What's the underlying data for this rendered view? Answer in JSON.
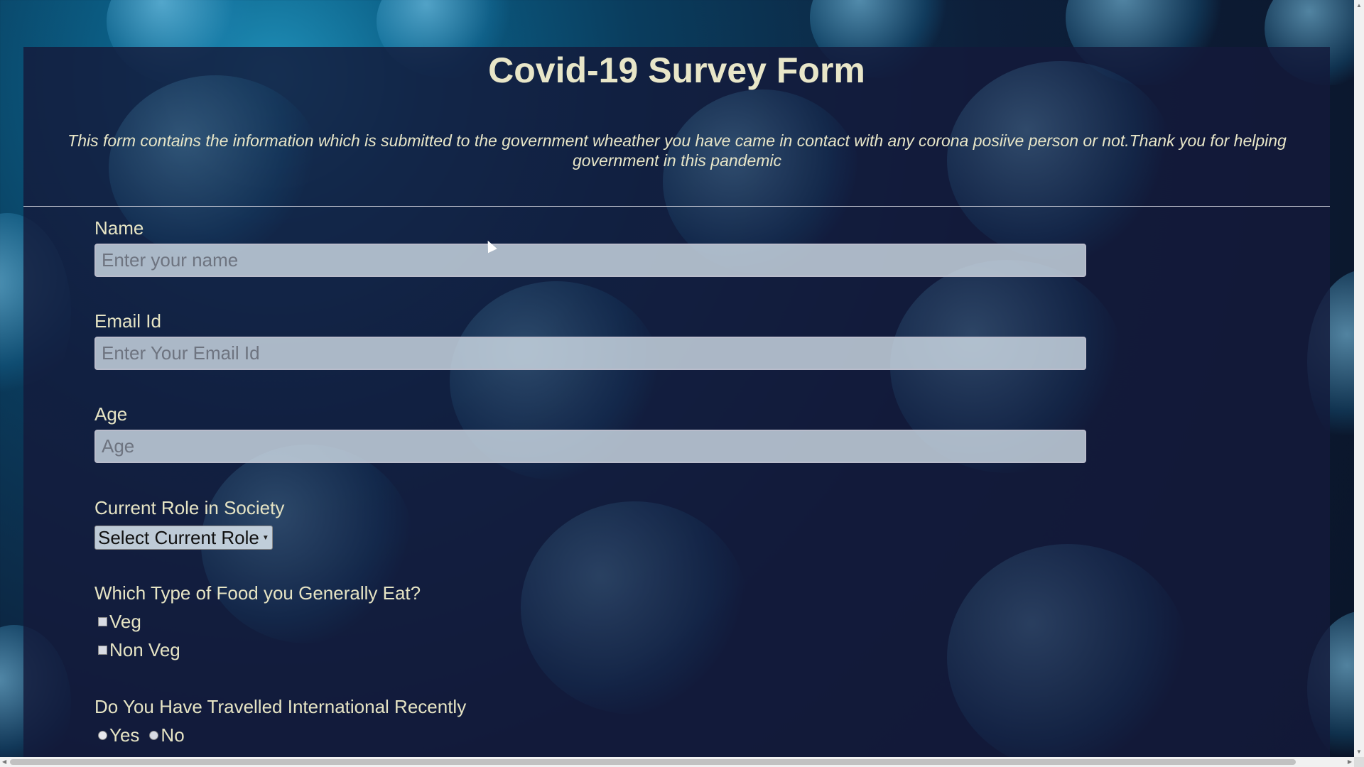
{
  "page": {
    "title": "Covid-19 Survey Form",
    "description": "This form contains the information which is submitted to the government wheather you have came in contact with any corona posiive person or not.Thank you for helping government in this pandemic"
  },
  "form": {
    "name": {
      "label": "Name",
      "placeholder": "Enter your name",
      "value": ""
    },
    "email": {
      "label": "Email Id",
      "placeholder": "Enter Your Email Id",
      "value": ""
    },
    "age": {
      "label": "Age",
      "placeholder": "Age",
      "value": ""
    },
    "role": {
      "label": "Current Role in Society",
      "selected": "Select Current Role"
    },
    "food": {
      "label": "Which Type of Food you Generally Eat?",
      "options": [
        "Veg",
        "Non Veg"
      ]
    },
    "travel": {
      "label": "Do You Have Travelled International Recently",
      "options": [
        "Yes",
        "No"
      ]
    }
  },
  "colors": {
    "text": "#e6e4c4",
    "panel": "#141a3a",
    "accent": "#0b5f86"
  }
}
